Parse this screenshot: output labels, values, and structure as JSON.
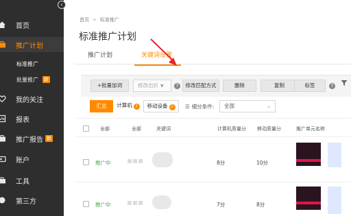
{
  "sidebar": {
    "collapse_icon": "chevron-left-icon",
    "items": [
      {
        "label": "首页",
        "icon": "home-icon"
      },
      {
        "label": "推广计划",
        "icon": "briefcase-icon"
      },
      {
        "label": "我的关注",
        "icon": "heart-icon"
      },
      {
        "label": "报表",
        "icon": "report-icon"
      },
      {
        "label": "推广报告",
        "icon": "briefcase-icon",
        "badge": "新"
      },
      {
        "label": "账户",
        "icon": "account-icon"
      },
      {
        "label": "工具",
        "icon": "toolbox-icon"
      },
      {
        "label": "第三方",
        "icon": "thirdparty-icon"
      }
    ],
    "sub_items": [
      {
        "label": "标准推广"
      },
      {
        "label": "批量推广",
        "badge": "新"
      }
    ],
    "active_color": "#ff8a00"
  },
  "breadcrumb": {
    "home": "首页",
    "current": "标准推广"
  },
  "page_title": "标准推广计划",
  "tabs": [
    {
      "label": "推广计划"
    },
    {
      "label": "关键词设置"
    }
  ],
  "toolbar": {
    "batch_add": "+批量加词",
    "modify_bid": "修改出价",
    "modify_match": "修改匹配方式",
    "delete": "删除",
    "copy": "复制",
    "tags": "标签"
  },
  "filters": {
    "summary": "汇总",
    "computer": "计算机",
    "mobile": "移动设备",
    "condition_label": "细分条件:",
    "condition_value": "全部"
  },
  "table": {
    "headers": {
      "all1": "全部",
      "all2": "全部",
      "keyword": "关键词",
      "pc_quality": "计算机质量分",
      "mobile_quality": "移动质量分",
      "unit_name": "推广单元名称"
    },
    "rows": [
      {
        "status": "推广中",
        "pc_quality": "8分",
        "mobile_quality": "10分"
      },
      {
        "status": "推广中",
        "pc_quality": "7分",
        "mobile_quality": "8分"
      }
    ]
  },
  "colors": {
    "accent": "#ff8a00",
    "status_active": "#49a14a",
    "sidebar_bg": "#2e2e2e",
    "annotation": "#e8232a"
  }
}
